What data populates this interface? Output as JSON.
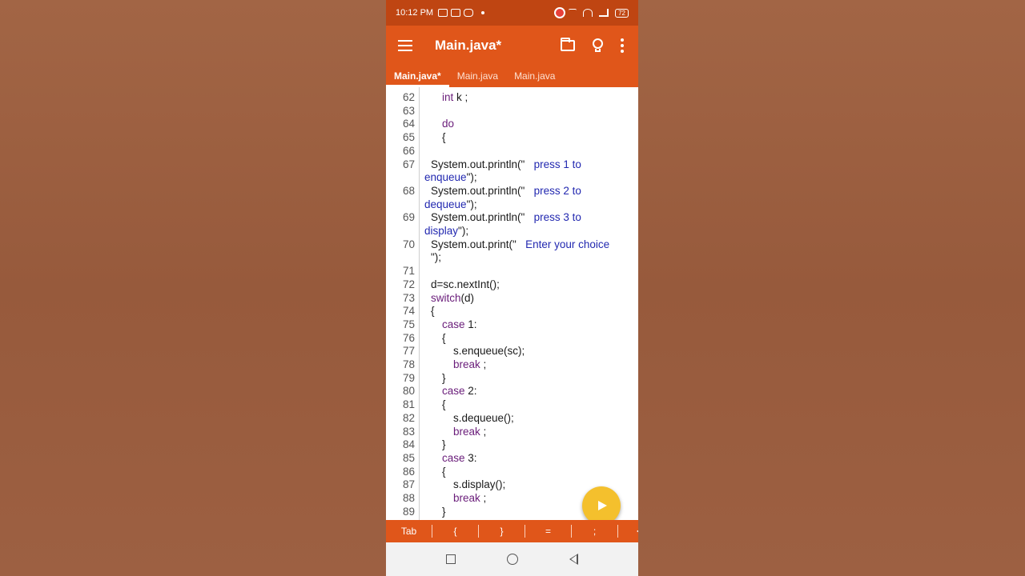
{
  "status_bar": {
    "time": "10:12 PM",
    "battery": "72"
  },
  "app_bar": {
    "title": "Main.java*"
  },
  "tabs": [
    {
      "label": "Main.java*",
      "active": true
    },
    {
      "label": "Main.java",
      "active": false
    },
    {
      "label": "Main.java",
      "active": false
    }
  ],
  "code_lines": [
    {
      "n": "62",
      "indent": 2,
      "tokens": [
        {
          "t": "int",
          "c": "kw"
        },
        {
          "t": " k ;",
          "c": ""
        }
      ]
    },
    {
      "n": "63",
      "indent": 0,
      "tokens": []
    },
    {
      "n": "64",
      "indent": 2,
      "tokens": [
        {
          "t": "do",
          "c": "kw"
        }
      ]
    },
    {
      "n": "65",
      "indent": 2,
      "tokens": [
        {
          "t": "{",
          "c": ""
        }
      ]
    },
    {
      "n": "66",
      "indent": 0,
      "tokens": []
    },
    {
      "n": "67",
      "indent": 1,
      "tokens": [
        {
          "t": "System.out.println(\"   ",
          "c": ""
        },
        {
          "t": "press 1 to",
          "c": "str"
        }
      ],
      "wrap": [
        {
          "t": "enqueue",
          "c": "str"
        },
        {
          "t": "\");",
          "c": ""
        }
      ]
    },
    {
      "n": "68",
      "indent": 1,
      "tokens": [
        {
          "t": "System.out.println(\"   ",
          "c": ""
        },
        {
          "t": "press 2 to",
          "c": "str"
        }
      ],
      "wrap": [
        {
          "t": "dequeue",
          "c": "str"
        },
        {
          "t": "\");",
          "c": ""
        }
      ]
    },
    {
      "n": "69",
      "indent": 1,
      "tokens": [
        {
          "t": "System.out.println(\"   ",
          "c": ""
        },
        {
          "t": "press 3 to",
          "c": "str"
        }
      ],
      "wrap": [
        {
          "t": "display",
          "c": "str"
        },
        {
          "t": "\");",
          "c": ""
        }
      ]
    },
    {
      "n": "70",
      "indent": 1,
      "tokens": [
        {
          "t": "System.out.print(\"   ",
          "c": ""
        },
        {
          "t": "Enter your choice",
          "c": "str"
        }
      ],
      "wrap2": [
        {
          "t": "\");",
          "c": ""
        }
      ]
    },
    {
      "n": "71",
      "indent": 0,
      "tokens": []
    },
    {
      "n": "72",
      "indent": 1,
      "tokens": [
        {
          "t": "d=sc.nextInt();",
          "c": ""
        }
      ]
    },
    {
      "n": "73",
      "indent": 1,
      "tokens": [
        {
          "t": "switch",
          "c": "kw"
        },
        {
          "t": "(d)",
          "c": ""
        }
      ]
    },
    {
      "n": "74",
      "indent": 1,
      "tokens": [
        {
          "t": "{",
          "c": ""
        }
      ]
    },
    {
      "n": "75",
      "indent": 2,
      "tokens": [
        {
          "t": "case",
          "c": "kw"
        },
        {
          "t": " 1:",
          "c": ""
        }
      ]
    },
    {
      "n": "76",
      "indent": 2,
      "tokens": [
        {
          "t": "{",
          "c": ""
        }
      ]
    },
    {
      "n": "77",
      "indent": 3,
      "tokens": [
        {
          "t": "s.enqueue(sc);",
          "c": ""
        }
      ]
    },
    {
      "n": "78",
      "indent": 3,
      "tokens": [
        {
          "t": "break",
          "c": "kw"
        },
        {
          "t": " ;",
          "c": ""
        }
      ]
    },
    {
      "n": "79",
      "indent": 2,
      "tokens": [
        {
          "t": "}",
          "c": ""
        }
      ]
    },
    {
      "n": "80",
      "indent": 2,
      "tokens": [
        {
          "t": "case",
          "c": "kw"
        },
        {
          "t": " 2:",
          "c": ""
        }
      ]
    },
    {
      "n": "81",
      "indent": 2,
      "tokens": [
        {
          "t": "{",
          "c": ""
        }
      ]
    },
    {
      "n": "82",
      "indent": 3,
      "tokens": [
        {
          "t": "s.dequeue();",
          "c": ""
        }
      ]
    },
    {
      "n": "83",
      "indent": 3,
      "tokens": [
        {
          "t": "break",
          "c": "kw"
        },
        {
          "t": " ;",
          "c": ""
        }
      ]
    },
    {
      "n": "84",
      "indent": 2,
      "tokens": [
        {
          "t": "}",
          "c": ""
        }
      ]
    },
    {
      "n": "85",
      "indent": 2,
      "tokens": [
        {
          "t": "case",
          "c": "kw"
        },
        {
          "t": " 3:",
          "c": ""
        }
      ]
    },
    {
      "n": "86",
      "indent": 2,
      "tokens": [
        {
          "t": "{",
          "c": ""
        }
      ]
    },
    {
      "n": "87",
      "indent": 3,
      "tokens": [
        {
          "t": "s.display();",
          "c": ""
        }
      ]
    },
    {
      "n": "88",
      "indent": 3,
      "tokens": [
        {
          "t": "break",
          "c": "kw"
        },
        {
          "t": " ;",
          "c": ""
        }
      ]
    },
    {
      "n": "89",
      "indent": 2,
      "tokens": [
        {
          "t": "}",
          "c": ""
        }
      ]
    }
  ],
  "key_bar": [
    "Tab",
    "{",
    "}",
    "=",
    ";",
    "<"
  ],
  "colors": {
    "app_bar": "#e0561a",
    "status_bar": "#bf4512",
    "fab": "#f4c02d",
    "keyword": "#6a1d7a",
    "string": "#2228b0"
  },
  "icons": [
    "menu-icon",
    "folder-icon",
    "lightbulb-icon",
    "more-vert-icon",
    "play-icon",
    "nav-recents-icon",
    "nav-home-icon",
    "nav-back-icon"
  ]
}
